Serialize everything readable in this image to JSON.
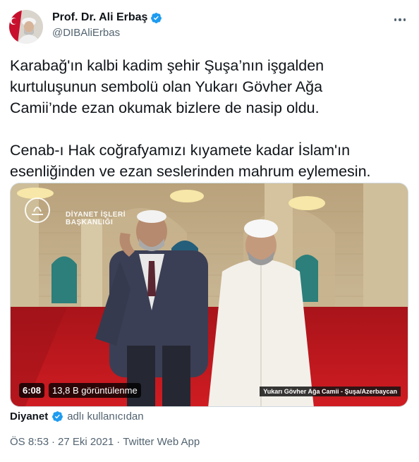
{
  "author": {
    "display_name": "Prof. Dr. Ali Erbaş",
    "handle": "@DIBAliErbas",
    "verified": true
  },
  "tweet": {
    "paragraph1": [
      "Karabağ'ın kalbi kadim şehir Şuşa’nın işgalden",
      "kurtuluşunun sembolü olan Yukarı Gövher Ağa",
      "Camii’nde ezan okumak bizlere de nasip oldu."
    ],
    "paragraph2": [
      "Cenab-ı Hak coğrafyamızı kıyamete kadar İslam'ın",
      "esenliğinden ve ezan seslerinden mahrum eylemesin."
    ]
  },
  "video": {
    "duration": "6:08",
    "views": "13,8 B görüntülenme",
    "caption": "Yukarı Gövher Ağa Camii - Şuşa/Azerbaycan",
    "logo_line1": "DİYANET İŞLERİ",
    "logo_line2": "BAŞKANLIĞI"
  },
  "source": {
    "name": "Diyanet",
    "suffix": "adlı kullanıcıdan"
  },
  "meta": {
    "time": "ÖS 8:53",
    "separator1": "·",
    "date": "27 Eki 2021",
    "separator2": "·",
    "app": "Twitter Web App"
  },
  "colors": {
    "verified": "#1d9bf0",
    "secondary_text": "#536471",
    "primary_text": "#0f1419",
    "carpet": "#c0161b"
  },
  "icons": {
    "verified": "verified-badge-icon",
    "more": "more-dots-icon"
  }
}
